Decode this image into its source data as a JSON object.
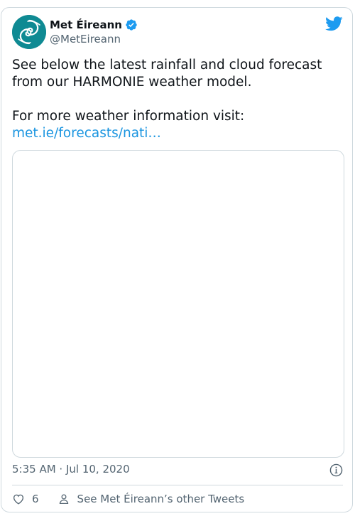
{
  "author": {
    "name": "Met Éireann",
    "handle": "@MetEireann",
    "verified": true,
    "avatar_icon": "met-eireann-swirl-logo",
    "avatar_color": "#0f8a93"
  },
  "tweet": {
    "text_line1": "See below the latest rainfall and cloud forecast from our HARMONIE weather model.",
    "text_line2": "For more weather information visit:",
    "link_text": "met.ie/forecasts/nati…"
  },
  "meta": {
    "timestamp": "5:35 AM · Jul 10, 2020"
  },
  "actions": {
    "like_count": "6",
    "profile_link": "See Met Éireann’s other Tweets"
  },
  "colors": {
    "brand": "#1d9bf0",
    "link": "#1b95e0",
    "text": "#0f1419",
    "muted": "#536471",
    "border": "#cfd9de"
  }
}
